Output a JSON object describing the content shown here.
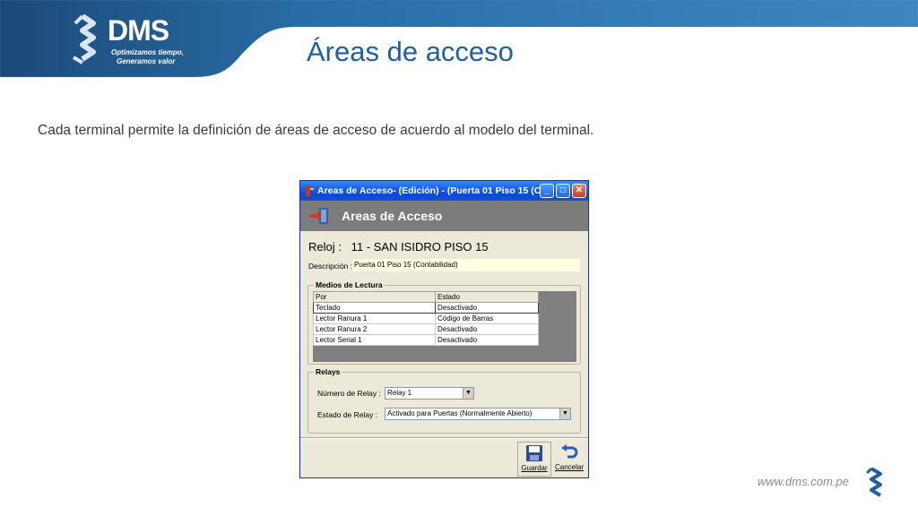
{
  "brand": {
    "name": "DMS",
    "tagline_line1": "Optimizamos tiempo,",
    "tagline_line2": "Generamos valor",
    "colors": {
      "dark_blue": "#1e4f80",
      "mid_blue": "#2a6ea8",
      "title_blue": "#1f5fa6"
    }
  },
  "slide": {
    "title": "Áreas de acceso",
    "body": "Cada terminal permite la definición de áreas de acceso de acuerdo al modelo del terminal.",
    "footer_url": "www.dms.com.pe"
  },
  "dialog": {
    "window_title": "Areas de Acceso- (Edición) - (Puerta 01 Piso 15 (C...",
    "header_title": "Areas de Acceso",
    "reloj_text": "Reloj :   11 - SAN ISIDRO PISO 15",
    "descripcion_label": "Descripción :",
    "descripcion_value": "Puerta 01 Piso 15 (Contabilidad)",
    "medios": {
      "group_title": "Medios de Lectura",
      "headers": [
        "Por",
        "Estado"
      ],
      "rows": [
        {
          "por": "Teclado",
          "estado": "Desactivado"
        },
        {
          "por": "Lector Ranura 1",
          "estado": "Código de Barras"
        },
        {
          "por": "Lector Ranura 2",
          "estado": "Desactivado"
        },
        {
          "por": "Lector Serial 1",
          "estado": "Desactivado"
        }
      ]
    },
    "relays": {
      "group_title": "Relays",
      "numero_label": "Número de Relay :",
      "numero_value": "Relay 1",
      "estado_label": "Estado de Relay :",
      "estado_value": "Activado para Puertas (Normalmente Abierto)"
    },
    "toolbar": {
      "save_label": "Guardar",
      "cancel_label": "Cancelar"
    }
  }
}
